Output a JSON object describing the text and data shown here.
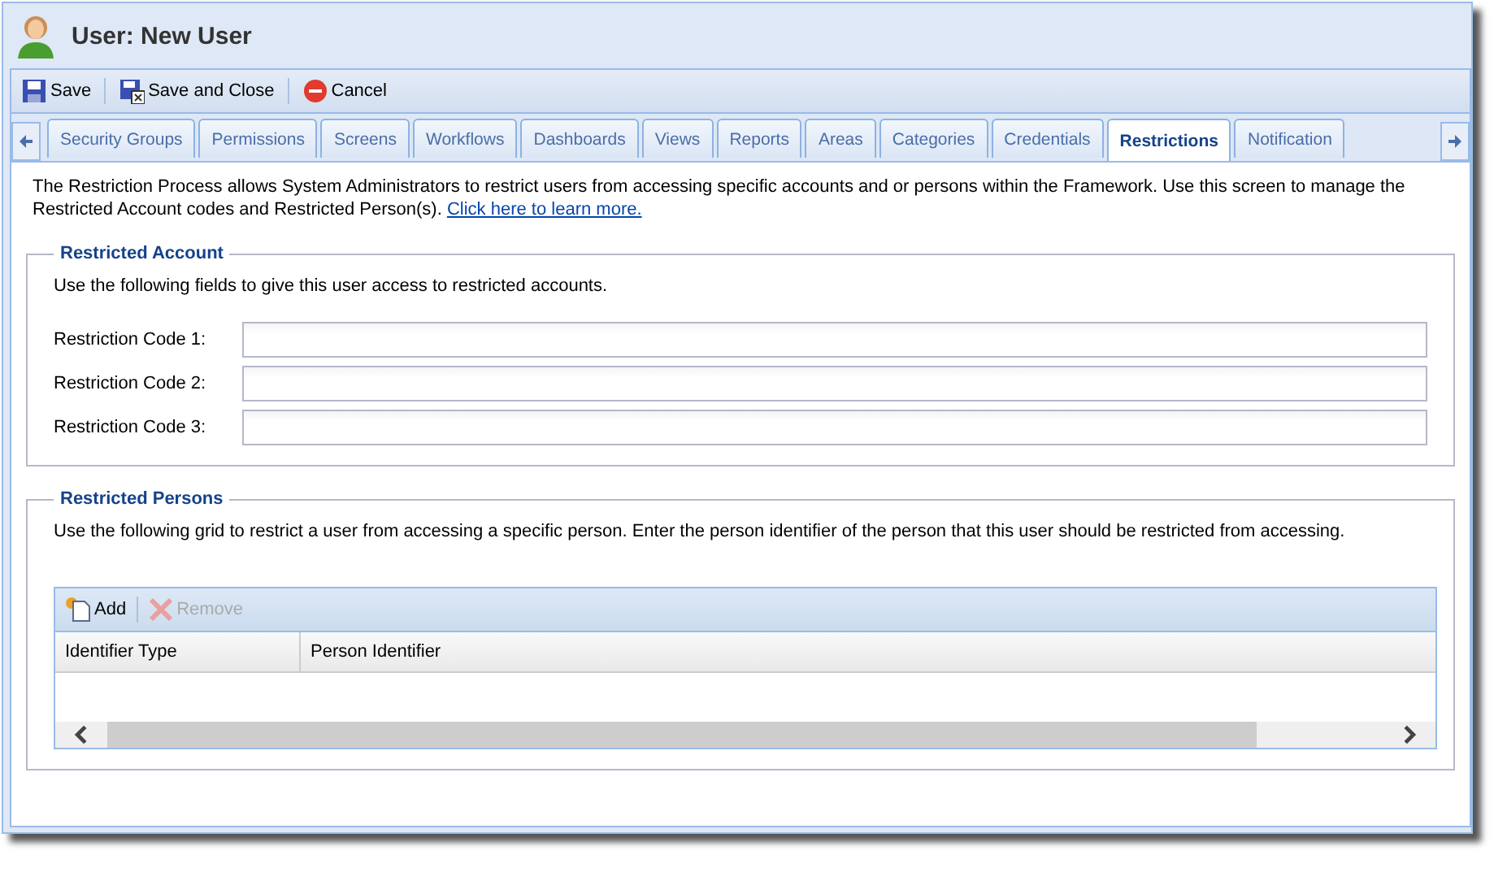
{
  "window": {
    "title": "User: New User"
  },
  "toolbar": [
    {
      "label": "Save",
      "kind": "save"
    },
    {
      "label": "Save and Close",
      "kind": "save-close"
    },
    {
      "label": "Cancel",
      "kind": "cancel"
    }
  ],
  "tabs": [
    {
      "label": "Security Groups",
      "selected": false
    },
    {
      "label": "Permissions",
      "selected": false
    },
    {
      "label": "Screens",
      "selected": false
    },
    {
      "label": "Workflows",
      "selected": false
    },
    {
      "label": "Dashboards",
      "selected": false
    },
    {
      "label": "Views",
      "selected": false
    },
    {
      "label": "Reports",
      "selected": false
    },
    {
      "label": "Areas",
      "selected": false
    },
    {
      "label": "Categories",
      "selected": false
    },
    {
      "label": "Credentials",
      "selected": false
    },
    {
      "label": "Restrictions",
      "selected": true
    },
    {
      "label": "Notification",
      "selected": false
    }
  ],
  "intro": {
    "text": "The Restriction Process allows System Administrators to restrict users from accessing specific accounts and or persons within the Framework. Use this screen to manage the Restricted Account codes and Restricted Person(s).",
    "link": "Click here to learn more."
  },
  "restricted_account": {
    "legend": "Restricted Account",
    "description": "Use the following fields to give this user access to restricted accounts.",
    "fields": [
      {
        "label": "Restriction Code 1:"
      },
      {
        "label": "Restriction Code 2:"
      },
      {
        "label": "Restriction Code 3:"
      }
    ]
  },
  "restricted_persons": {
    "legend": "Restricted Persons",
    "description": "Use the following grid to restrict a user from accessing a specific person. Enter the person identifier of the person that this user should be restricted from accessing.",
    "grid_toolbar": [
      {
        "label": "Add",
        "kind": "add",
        "disabled": false
      },
      {
        "label": "Remove",
        "kind": "remove",
        "disabled": true
      }
    ],
    "columns": [
      "Identifier Type",
      "Person Identifier"
    ]
  }
}
